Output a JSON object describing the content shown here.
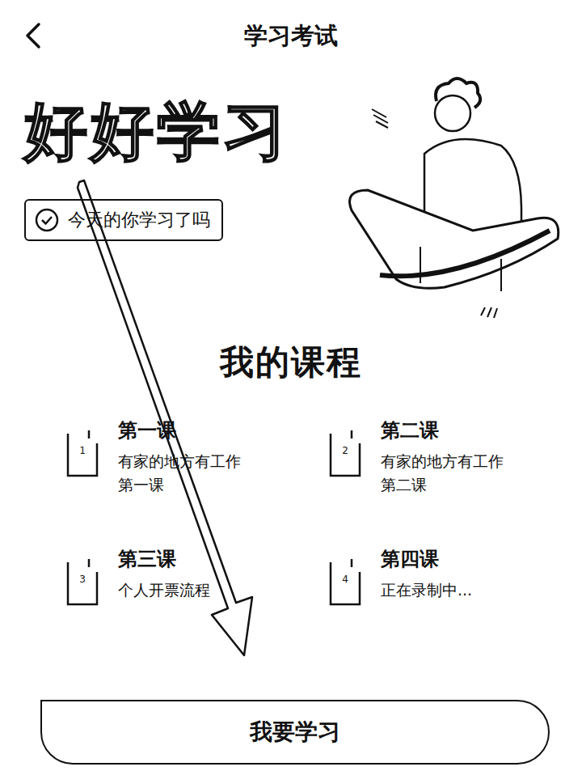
{
  "header": {
    "title": "学习考试"
  },
  "hero": {
    "title": "好好学习",
    "badge": "今天的你学习了吗"
  },
  "courses": {
    "title": "我的课程",
    "items": [
      {
        "num": "1",
        "title": "第一课",
        "desc": "有家的地方有工作第一课"
      },
      {
        "num": "2",
        "title": "第二课",
        "desc": "有家的地方有工作第二课"
      },
      {
        "num": "3",
        "title": "第三课",
        "desc": "个人开票流程"
      },
      {
        "num": "4",
        "title": "第四课",
        "desc": "正在录制中..."
      }
    ]
  },
  "button": "我要学习"
}
